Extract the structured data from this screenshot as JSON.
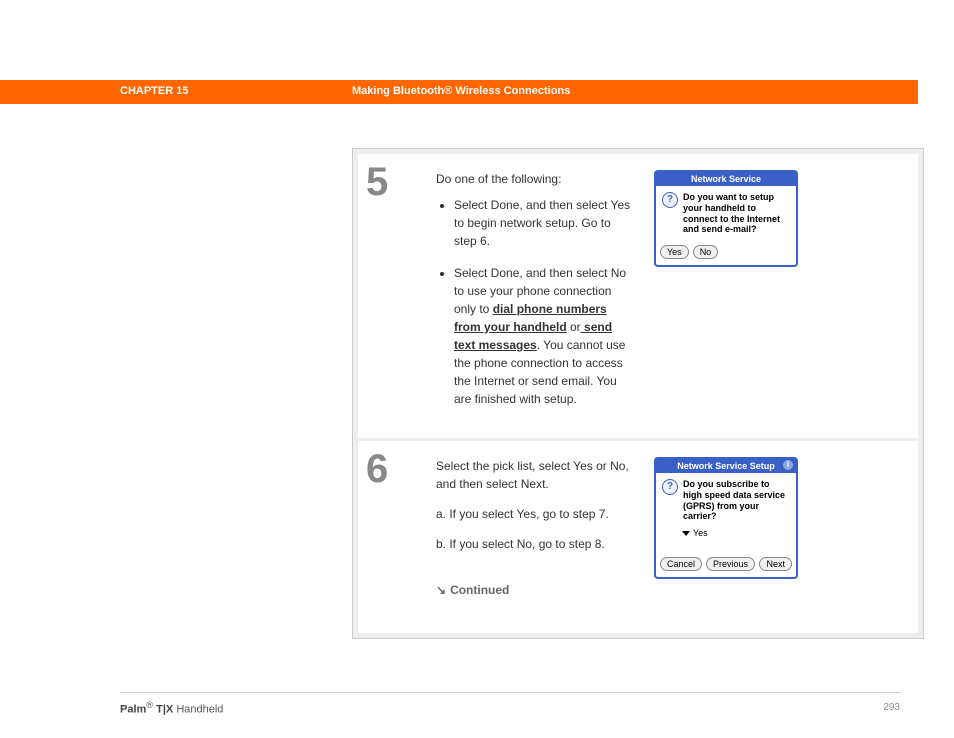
{
  "header": {
    "chapter": "CHAPTER 15",
    "title": "Making Bluetooth® Wireless Connections"
  },
  "steps": [
    {
      "num": "5",
      "intro": "Do one of the following:",
      "bullets": [
        {
          "pre": "Select Done, and then select Yes to begin network setup. Go to step 6."
        },
        {
          "pre": "Select Done, and then select No to use your phone connection only to ",
          "link1": "dial phone numbers from your handheld",
          "mid": " or",
          "link2": " send text messages",
          "post": ". You cannot use the phone connection to access the Internet or send email. You are finished with setup."
        }
      ],
      "dialog": {
        "title": "Network Service",
        "body": "Do you want to setup your handheld to connect to the Internet and send e-mail?",
        "buttons": [
          "Yes",
          "No"
        ]
      }
    },
    {
      "num": "6",
      "intro": "Select the pick list, select Yes or No, and then select Next.",
      "subs": [
        "a.  If you select Yes, go to step 7.",
        "b.  If you select No, go to step 8."
      ],
      "continued": "Continued",
      "dialog": {
        "title": "Network Service Setup",
        "body": "Do you subscribe to high speed data service (GPRS) from your carrier?",
        "picklist": "Yes",
        "buttons": [
          "Cancel",
          "Previous",
          "Next"
        ]
      }
    }
  ],
  "footer": {
    "brand": "Palm",
    "model": "T|X",
    "suffix": "Handheld",
    "page": "293"
  }
}
